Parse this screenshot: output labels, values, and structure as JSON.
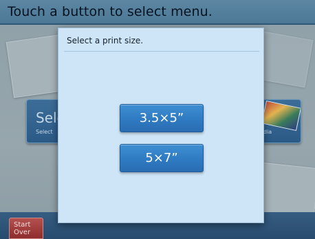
{
  "header": {
    "title": "Touch a button to select menu."
  },
  "background_tiles": {
    "left": {
      "title": "Sele",
      "subtitle": "Select"
    },
    "right": {
      "subtitle": "dia"
    }
  },
  "footer": {
    "start_over_label": "Start\nOver"
  },
  "dialog": {
    "title": "Select a print size.",
    "options": [
      {
        "label": "3.5×5”"
      },
      {
        "label": "5×7”"
      }
    ]
  },
  "colors": {
    "dialog_bg": "#cde5f6",
    "button_blue": "#2f7ac2",
    "start_over_red": "#a03c3b"
  }
}
